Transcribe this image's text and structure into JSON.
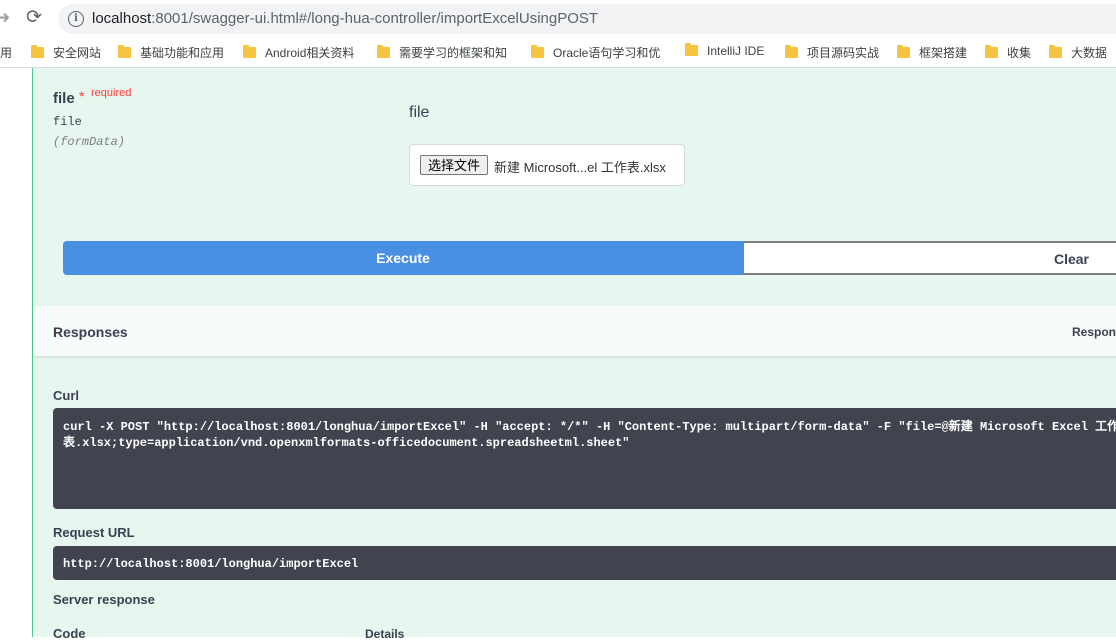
{
  "browser": {
    "url_host": "localhost",
    "url_rest": ":8001/swagger-ui.html#/long-hua-controller/importExcelUsingPOST",
    "bookmarks": [
      {
        "label": "用",
        "folder": false
      },
      {
        "label": "安全网站",
        "folder": true
      },
      {
        "label": "基础功能和应用",
        "folder": true
      },
      {
        "label": "Android相关资料",
        "folder": true
      },
      {
        "label": "需要学习的框架和知",
        "folder": true
      },
      {
        "label": "Oracle语句学习和优",
        "folder": true
      },
      {
        "label": "IntelliJ IDE",
        "folder": true
      },
      {
        "label": "项目源码实战",
        "folder": true
      },
      {
        "label": "框架搭建",
        "folder": true
      },
      {
        "label": "收集",
        "folder": true
      },
      {
        "label": "大数据",
        "folder": true
      }
    ]
  },
  "parameter": {
    "name": "file",
    "star": "*",
    "required": "required",
    "type": "file",
    "in": "(formData)",
    "description": "file",
    "file_button": "选择文件",
    "file_name": "新建 Microsoft...el 工作表.xlsx"
  },
  "actions": {
    "execute": "Execute",
    "clear": "Clear"
  },
  "responses": {
    "title": "Responses",
    "right_label": "Respons",
    "curl_label": "Curl",
    "curl_command": "curl -X POST \"http://localhost:8001/longhua/importExcel\" -H \"accept: */*\" -H \"Content-Type: multipart/form-data\" -F \"file=@新建 Microsoft Excel 工作表.xlsx;type=application/vnd.openxmlformats-officedocument.spreadsheetml.sheet\"",
    "request_url_label": "Request URL",
    "request_url": "http://localhost:8001/longhua/importExcel",
    "server_response_label": "Server response",
    "col_code": "Code",
    "col_details": "Details"
  }
}
